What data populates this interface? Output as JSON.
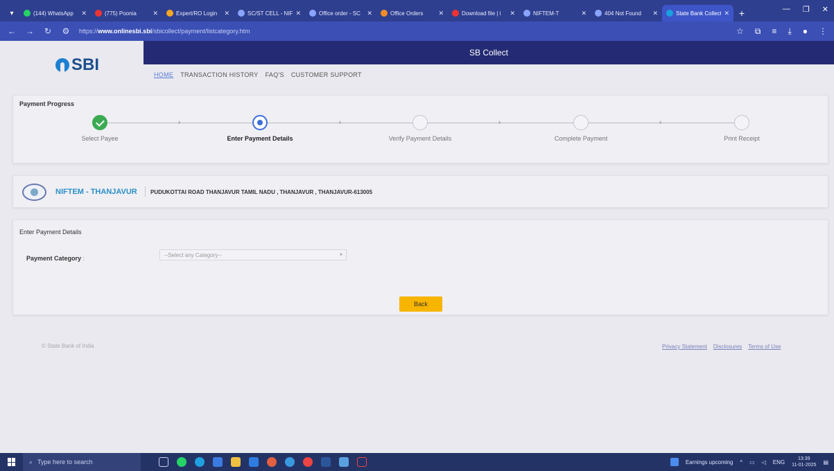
{
  "browser": {
    "tabs": [
      {
        "label": "(144) WhatsApp",
        "color": "#25d366",
        "active": false
      },
      {
        "label": "(775) Poonia",
        "color": "#e33",
        "active": false
      },
      {
        "label": "Expert/RO Login",
        "color": "#f5a623",
        "active": false
      },
      {
        "label": "SC/ST CELL - NIF",
        "color": "#8aa4ff",
        "active": false
      },
      {
        "label": "Office order - SC",
        "color": "#8aa4ff",
        "active": false
      },
      {
        "label": "Office Orders",
        "color": "#f28c28",
        "active": false
      },
      {
        "label": "Download file | i",
        "color": "#e33",
        "active": false
      },
      {
        "label": "NIFTEM-T",
        "color": "#8aa4ff",
        "active": false
      },
      {
        "label": "404 Not Found",
        "color": "#8aa4ff",
        "active": false
      },
      {
        "label": "State Bank Collect",
        "color": "#1c9fe0",
        "active": true
      }
    ],
    "url_prefix": "https://",
    "url_domain": "www.onlinesbi.sbi",
    "url_path": "/sbicollect/payment/listcategory.htm"
  },
  "header": {
    "logo_text": "SBI",
    "banner": "SB Collect",
    "nav": [
      "HOME",
      "TRANSACTION HISTORY",
      "FAQ'S",
      "CUSTOMER SUPPORT"
    ]
  },
  "progress": {
    "title": "Payment Progress",
    "steps": [
      {
        "label": "Select Payee",
        "state": "done"
      },
      {
        "label": "Enter Payment Details",
        "state": "current"
      },
      {
        "label": "Verify Payment Details",
        "state": "pending"
      },
      {
        "label": "Complete Payment",
        "state": "pending"
      },
      {
        "label": "Print Receipt",
        "state": "pending"
      }
    ]
  },
  "payee": {
    "name": "NIFTEM - THANJAVUR",
    "address": "PUDUKOTTAI ROAD THANJAVUR TAMIL NADU , THANJAVUR , THANJAVUR-613005"
  },
  "details": {
    "title": "Enter Payment Details",
    "category_label": "Payment Category",
    "category_colon": ":",
    "category_placeholder": "--Select any Category--",
    "back_label": "Back"
  },
  "footer": {
    "copyright": "© State Bank of India",
    "links": [
      "Privacy Statement",
      "Disclosures",
      "Terms of Use"
    ]
  },
  "taskbar": {
    "search_placeholder": "Type here to search",
    "tray_text": "Earnings upcoming",
    "lang": "ENG",
    "time": "13:39",
    "date": "11-01-2025"
  },
  "colors": {
    "banner": "#242b74",
    "accent": "#2a8fc8",
    "done": "#3caa52",
    "current": "#3d6fd6",
    "back_button": "#f7b500"
  }
}
